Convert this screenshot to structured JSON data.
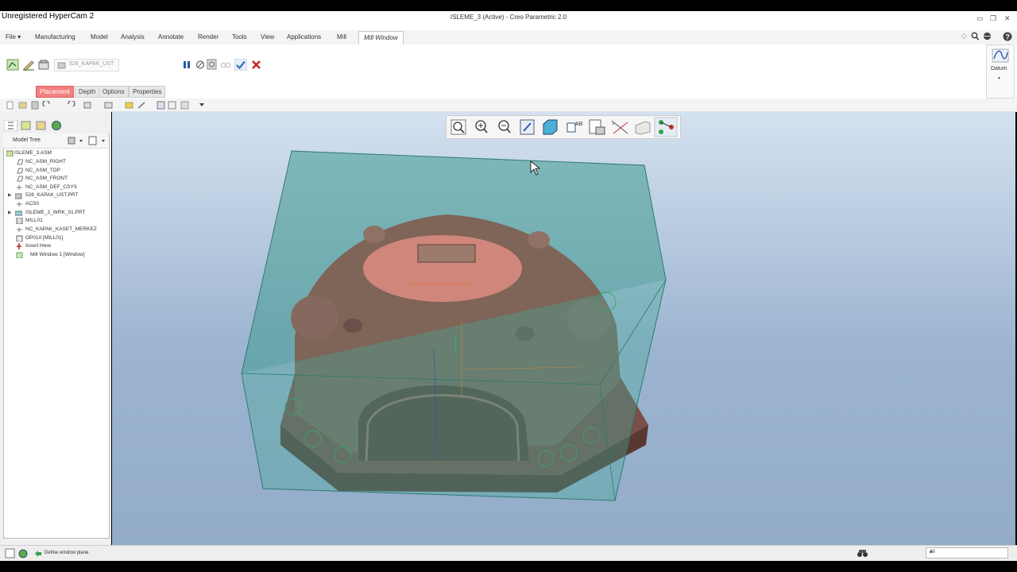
{
  "recorder_watermark": "Unregistered HyperCam 2",
  "window": {
    "title": "ISLEME_3 (Active) - Creo Parametric 2.0"
  },
  "menu": {
    "file": "File ▾",
    "tabs": [
      "Manufacturing",
      "Model",
      "Analysis",
      "Annotate",
      "Render",
      "Tools",
      "View",
      "Applications",
      "Mill"
    ],
    "active_tab": "Mill Window"
  },
  "ribbon": {
    "reference_placeholder": "526_KAPAK_UST",
    "subtabs": [
      "Placement",
      "Depth",
      "Options",
      "Properties"
    ],
    "datum_label": "Datum"
  },
  "model_tree": {
    "header": "Model Tree",
    "items": [
      "ISLEME_3.ASM",
      "NC_ASM_RIGHT",
      "NC_ASM_TOP",
      "NC_ASM_FRONT",
      "NC_ASM_DEF_CSYS",
      "526_KAPAK_UST.PRT",
      "ISLEME_3_WRK_01.PRT",
      "ACS0",
      "MILL01",
      "NC_KAPAK_KASET_MERKEZ",
      "OP010 [MILL01]",
      "Insert Here",
      "Mill Window 1 [Window]"
    ]
  },
  "status": {
    "message": "Define window plane.",
    "filter_value": "All"
  },
  "colors": {
    "accent_red": "#f18080",
    "viewport_top": "#d4e2f0",
    "viewport_bottom": "#93acc9",
    "workpiece_box": "#4fa89a",
    "part": "#8a6a5c"
  }
}
